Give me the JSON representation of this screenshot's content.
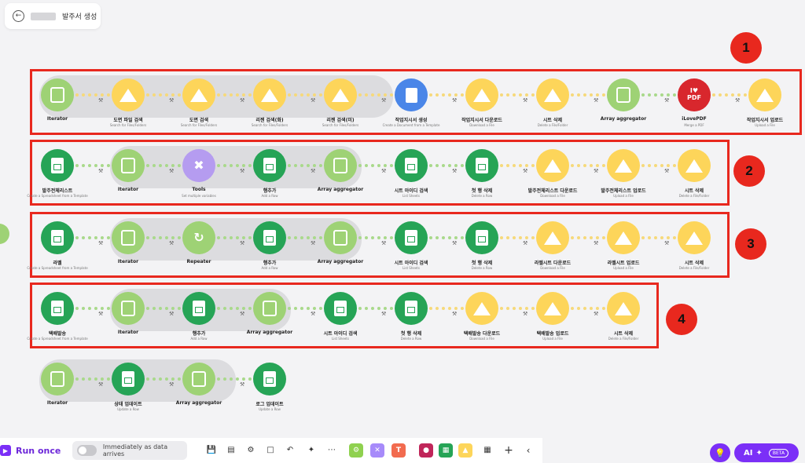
{
  "header": {
    "title": "발주서 생성",
    "back_icon": "back-arrow-icon"
  },
  "badges": [
    "1",
    "2",
    "3",
    "4"
  ],
  "routes": [
    {
      "modules": [
        {
          "label": "Iterator",
          "sub": "",
          "kind": "iterator"
        },
        {
          "label": "도면 파일 검색",
          "sub": "Search for Files/Folders",
          "kind": "drive"
        },
        {
          "label": "도면 검색",
          "sub": "Search for Files/Folders",
          "kind": "drive"
        },
        {
          "label": "리젠 검색(화)",
          "sub": "Search for Files/Folders",
          "kind": "drive"
        },
        {
          "label": "리젠 검색(미)",
          "sub": "Search for Files/Folders",
          "kind": "drive"
        },
        {
          "label": "작업지시서 생성",
          "sub": "Create a Document from a Template",
          "kind": "docs"
        },
        {
          "label": "작업지시서 다운로드",
          "sub": "Download a File",
          "kind": "drive"
        },
        {
          "label": "시트 삭제",
          "sub": "Delete a File/Folder",
          "kind": "drive"
        },
        {
          "label": "Array aggregator",
          "sub": "",
          "kind": "aggregator"
        },
        {
          "label": "iLovePDF",
          "sub": "Merge a PDF",
          "kind": "pdf"
        },
        {
          "label": "작업지시서 업로드",
          "sub": "Upload a File",
          "kind": "drive"
        }
      ]
    },
    {
      "modules": [
        {
          "label": "발주전체리스트",
          "sub": "Create a Spreadsheet from a Template",
          "kind": "sheets"
        },
        {
          "label": "Iterator",
          "sub": "",
          "kind": "iterator"
        },
        {
          "label": "Tools",
          "sub": "Set multiple variables",
          "kind": "tools"
        },
        {
          "label": "행추가",
          "sub": "Add a Row",
          "kind": "sheets"
        },
        {
          "label": "Array aggregator",
          "sub": "",
          "kind": "aggregator"
        },
        {
          "label": "시트 아이디 검색",
          "sub": "List Sheets",
          "kind": "sheets"
        },
        {
          "label": "첫 행 삭제",
          "sub": "Delete a Row",
          "kind": "sheets"
        },
        {
          "label": "발주전체리스트 다운로드",
          "sub": "Download a File",
          "kind": "drive"
        },
        {
          "label": "발주전체리스트 업로드",
          "sub": "Upload a File",
          "kind": "drive"
        },
        {
          "label": "시트 삭제",
          "sub": "Delete a File/Folder",
          "kind": "drive"
        }
      ]
    },
    {
      "modules": [
        {
          "label": "라벨",
          "sub": "Create a Spreadsheet from a Template",
          "kind": "sheets"
        },
        {
          "label": "Iterator",
          "sub": "",
          "kind": "iterator"
        },
        {
          "label": "Repeater",
          "sub": "",
          "kind": "repeater"
        },
        {
          "label": "행추가",
          "sub": "Add a Row",
          "kind": "sheets"
        },
        {
          "label": "Array aggregator",
          "sub": "",
          "kind": "aggregator"
        },
        {
          "label": "시트 아이디 검색",
          "sub": "List Sheets",
          "kind": "sheets"
        },
        {
          "label": "첫 행 삭제",
          "sub": "Delete a Row",
          "kind": "sheets"
        },
        {
          "label": "라벨시트 다운로드",
          "sub": "Download a File",
          "kind": "drive"
        },
        {
          "label": "라벨시트 업로드",
          "sub": "Upload a File",
          "kind": "drive"
        },
        {
          "label": "시트 삭제",
          "sub": "Delete a File/Folder",
          "kind": "drive"
        }
      ]
    },
    {
      "modules": [
        {
          "label": "택배발송",
          "sub": "Create a Spreadsheet from a Template",
          "kind": "sheets"
        },
        {
          "label": "Iterator",
          "sub": "",
          "kind": "iterator"
        },
        {
          "label": "행추가",
          "sub": "Add a Row",
          "kind": "sheets"
        },
        {
          "label": "Array aggregator",
          "sub": "",
          "kind": "aggregator"
        },
        {
          "label": "시트 아이디 검색",
          "sub": "List Sheets",
          "kind": "sheets"
        },
        {
          "label": "첫 행 삭제",
          "sub": "Delete a Row",
          "kind": "sheets"
        },
        {
          "label": "택배발송 다운로드",
          "sub": "Download a File",
          "kind": "drive"
        },
        {
          "label": "택배발송 업로드",
          "sub": "Upload a File",
          "kind": "drive"
        },
        {
          "label": "시트 삭제",
          "sub": "Delete a File/Folder",
          "kind": "drive"
        }
      ]
    },
    {
      "modules": [
        {
          "label": "Iterator",
          "sub": "",
          "kind": "iterator"
        },
        {
          "label": "상태 업데이트",
          "sub": "Update a Row",
          "kind": "sheets"
        },
        {
          "label": "Array aggregator",
          "sub": "",
          "kind": "aggregator"
        },
        {
          "label": "로그 업데이트",
          "sub": "Update a Row",
          "kind": "sheets"
        }
      ]
    }
  ],
  "toolbar": {
    "run_label": "Run once",
    "schedule_label": "Immediately as data arrives",
    "icons": [
      "save-icon",
      "template-icon",
      "settings-icon",
      "notes-icon",
      "undo-icon",
      "magic-wand-icon",
      "more-icon"
    ],
    "apps": [
      "tools-app",
      "flow-control-app",
      "text-parser-app",
      "webhooks-app",
      "google-sheets-app",
      "google-drive-app",
      "grid-app"
    ],
    "ai_label": "AI",
    "beta_label": "BETA"
  },
  "colors": {
    "accent": "#7b2ff7",
    "highlight": "#e8281e",
    "green": "#9ed275",
    "sheets": "#26a456",
    "drive": "#fdd55a"
  }
}
